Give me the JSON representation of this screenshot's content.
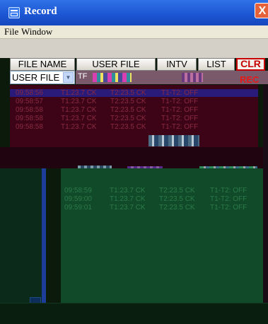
{
  "window": {
    "title": "Record",
    "close_label": "X"
  },
  "menu": [
    "File",
    "Window"
  ],
  "toolbar": {
    "buttons": [
      {
        "label": "FILE NAME"
      },
      {
        "label": "USER FILE"
      },
      {
        "label": "INTV"
      },
      {
        "label": "LIST"
      },
      {
        "label": "CLR"
      }
    ],
    "file_select": {
      "value": "USER FILE"
    },
    "input_prefix": "TF",
    "rec_label": "REC"
  },
  "upper_records": [
    {
      "time": "09:58:56",
      "t1": "T1:23.7 CK",
      "t2": "T2:23.5 CK",
      "diff": "T1-T2: OFF"
    },
    {
      "time": "09:58:57",
      "t1": "T1:23.7 CK",
      "t2": "T2:23.5 CK",
      "diff": "T1-T2: OFF"
    },
    {
      "time": "09:58:58",
      "t1": "T1:23.7 CK",
      "t2": "T2:23.5 CK",
      "diff": "T1-T2: OFF"
    },
    {
      "time": "09:58:58",
      "t1": "T1:23.7 CK",
      "t2": "T2:23.5 CK",
      "diff": "T1-T2: OFF"
    },
    {
      "time": "09:58:58",
      "t1": "T1:23.7 CK",
      "t2": "T2:23.5 CK",
      "diff": "T1-T2: OFF"
    }
  ],
  "lower_records": [
    {
      "time": "09:58:59",
      "t1": "T1:23.7 CK",
      "t2": "T2:23.5 CK",
      "diff": "T1-T2: OFF"
    },
    {
      "time": "09:59:00",
      "t1": "T1:23.7 CK",
      "t2": "T2:23.5 CK",
      "diff": "T1-T2: OFF"
    },
    {
      "time": "09:59:01",
      "t1": "T1:23.7 CK",
      "t2": "T2:23.5 CK",
      "diff": "T1-T2: OFF"
    }
  ],
  "colors": {
    "titlebar": "#1c55d2",
    "clr_accent": "#c80000",
    "rec": "#e81818",
    "upper_list_bg": "#3d0418",
    "lower_list_bg": "#104a28",
    "lower_text": "#2d7a4a"
  }
}
